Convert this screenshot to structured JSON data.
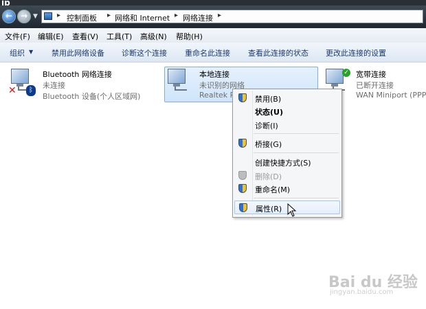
{
  "window": {
    "title": "ip"
  },
  "address": {
    "crumbs": [
      "控制面板",
      "网络和 Internet",
      "网络连接"
    ]
  },
  "menubar": {
    "items": [
      "文件(F)",
      "编辑(E)",
      "查看(V)",
      "工具(T)",
      "高级(N)",
      "帮助(H)"
    ]
  },
  "toolbar": {
    "items": [
      "组织",
      "禁用此网络设备",
      "诊断这个连接",
      "重命名此连接",
      "查看此连接的状态",
      "更改此连接的设置"
    ]
  },
  "connections": [
    {
      "name": "Bluetooth 网络连接",
      "status": "未连接",
      "device": "Bluetooth 设备(个人区域网)"
    },
    {
      "name": "本地连接",
      "status": "未识别的网络",
      "device": "Realtek P"
    },
    {
      "name": "宽带连接",
      "status": "已断开连接",
      "device": "WAN Miniport (PPP"
    }
  ],
  "context_menu": {
    "items": [
      {
        "label": "禁用(B)",
        "shield": true
      },
      {
        "label": "状态(U)",
        "bold": true
      },
      {
        "label": "诊断(I)"
      },
      {
        "label": "桥接(G)",
        "shield": true
      },
      {
        "label": "创建快捷方式(S)"
      },
      {
        "label": "删除(D)",
        "disabled": true,
        "shield": true
      },
      {
        "label": "重命名(M)",
        "shield": true
      },
      {
        "label": "属性(R)",
        "shield": true,
        "hover": true
      }
    ]
  },
  "watermark": {
    "brand": "Bai du 经验",
    "url": "jingyan.baidu.com"
  },
  "icons": {
    "back": "back-arrow-icon",
    "forward": "forward-arrow-icon",
    "network": "network-adapter-icon",
    "shield": "uac-shield-icon",
    "bluetooth": "bluetooth-icon",
    "cursor": "mouse-cursor-icon"
  }
}
